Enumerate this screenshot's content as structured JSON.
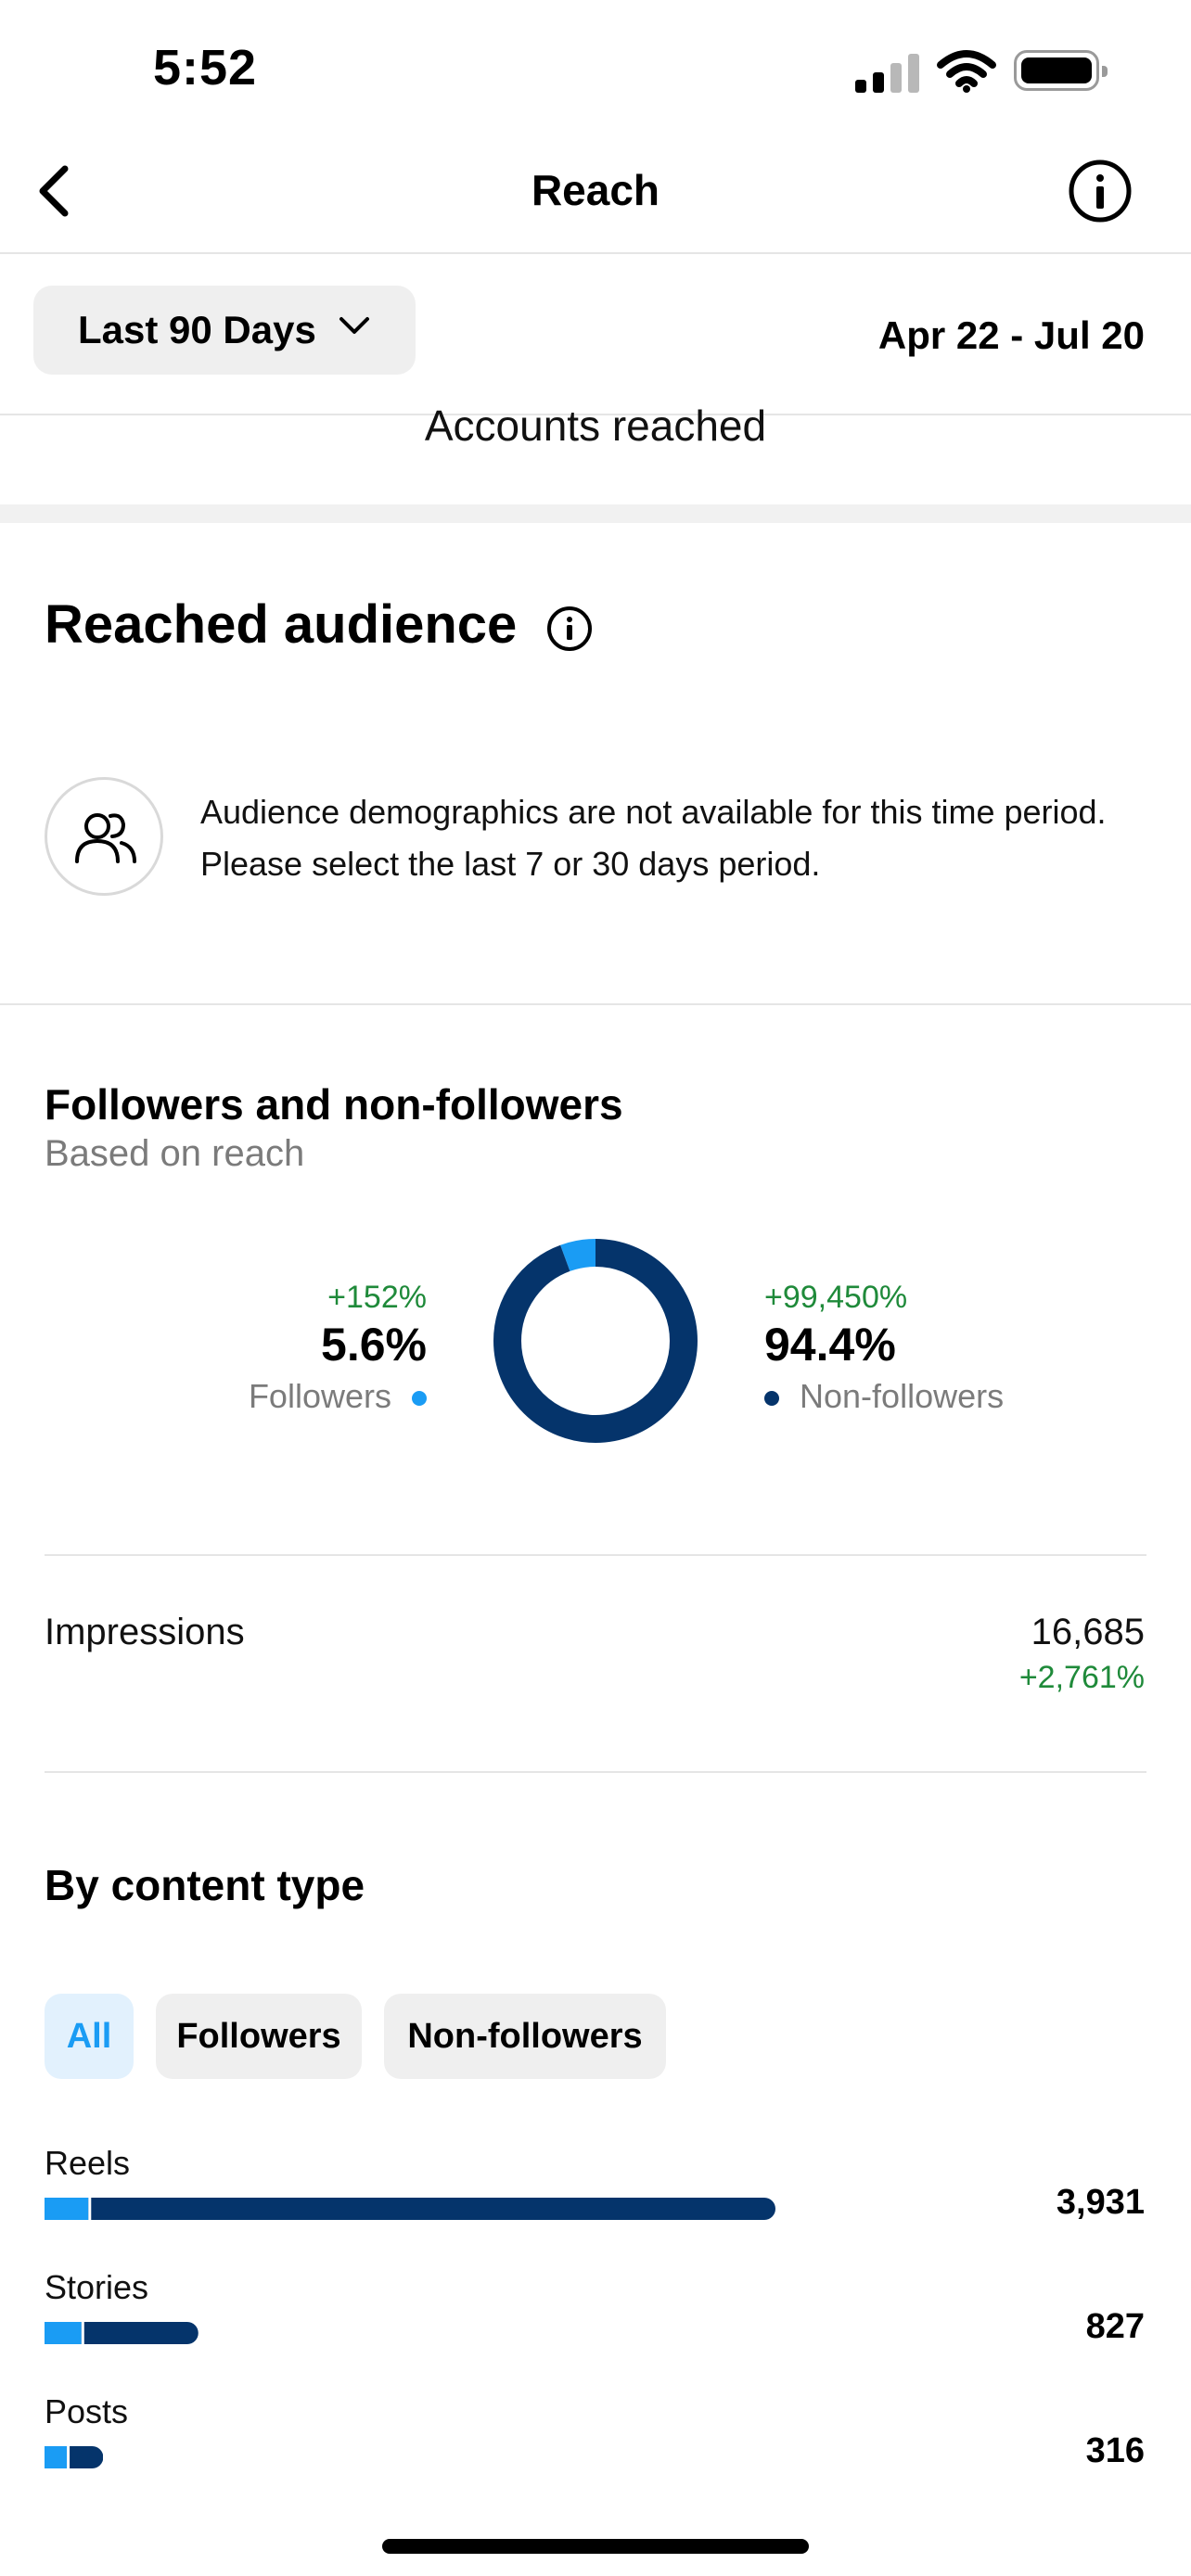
{
  "status_bar": {
    "time": "5:52"
  },
  "nav": {
    "title": "Reach",
    "back_icon": "chevron-left-icon",
    "info_icon": "info-icon"
  },
  "filter": {
    "range_label": "Last 90 Days",
    "date_range": "Apr 22 - Jul 20"
  },
  "accounts_reached_label": "Accounts reached",
  "reached_audience": {
    "title": "Reached audience",
    "notice": "Audience demographics are not available for this time period. Please select the last 7 or 30 days period."
  },
  "followers_split": {
    "title": "Followers and non-followers",
    "subtitle": "Based on reach",
    "followers": {
      "change": "+152%",
      "percent": "5.6%",
      "label": "Followers",
      "value": 5.6
    },
    "non_followers": {
      "change": "+99,450%",
      "percent": "94.4%",
      "label": "Non-followers",
      "value": 94.4
    },
    "colors": {
      "followers": "#1a9cf4",
      "non_followers": "#05346b"
    }
  },
  "impressions": {
    "label": "Impressions",
    "value": "16,685",
    "change": "+2,761%"
  },
  "content_type": {
    "title": "By content type",
    "chips": [
      {
        "label": "All",
        "selected": true
      },
      {
        "label": "Followers",
        "selected": false
      },
      {
        "label": "Non-followers",
        "selected": false
      }
    ],
    "rows": [
      {
        "label": "Reels",
        "value": "3,931",
        "total": 3931,
        "followers_share": 0.06
      },
      {
        "label": "Stories",
        "value": "827",
        "total": 827,
        "followers_share": 0.24
      },
      {
        "label": "Posts",
        "value": "316",
        "total": 316,
        "followers_share": 0.38
      }
    ]
  },
  "colors": {
    "accent_green": "#1f8a3a",
    "chip_selected_bg": "#e2f1fd",
    "chip_selected_text": "#1a9cf4"
  }
}
